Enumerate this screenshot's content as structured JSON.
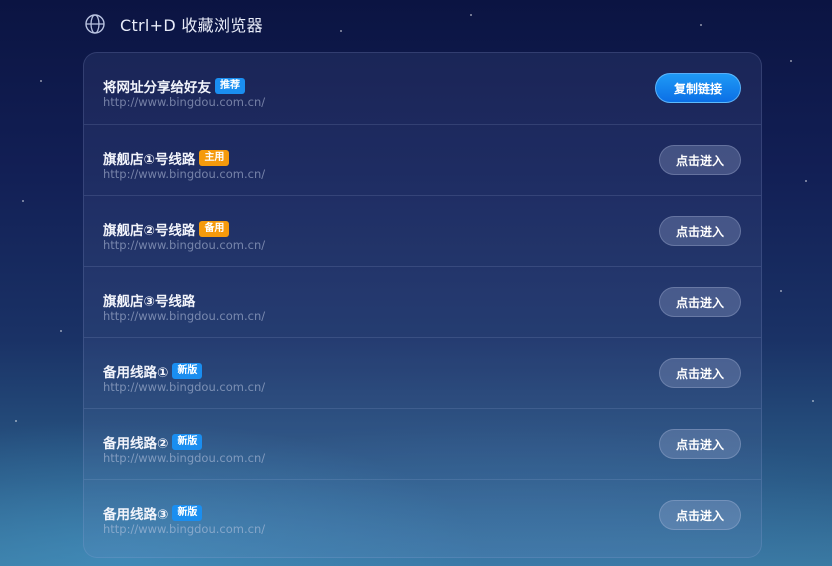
{
  "header": {
    "icon": "globe-icon",
    "title": "Ctrl+D 收藏浏览器"
  },
  "rows": [
    {
      "name": "将网址分享给好友",
      "tag": "推荐",
      "tag_color": "#1a8ef0",
      "url": "http://www.bingdou.com.cn/",
      "button": "复制链接",
      "button_style": "primary"
    },
    {
      "name": "旗舰店①号线路",
      "tag": "主用",
      "tag_color": "#f59a0c",
      "url": "http://www.bingdou.com.cn/",
      "button": "点击进入"
    },
    {
      "name": "旗舰店②号线路",
      "tag": "备用",
      "tag_color": "#f59a0c",
      "url": "http://www.bingdou.com.cn/",
      "button": "点击进入"
    },
    {
      "name": "旗舰店③号线路",
      "tag": "",
      "url": "http://www.bingdou.com.cn/",
      "button": "点击进入"
    },
    {
      "name": "备用线路①",
      "tag": "新版",
      "tag_color": "#1a8ef0",
      "url": "http://www.bingdou.com.cn/",
      "button": "点击进入"
    },
    {
      "name": "备用线路②",
      "tag": "新版",
      "tag_color": "#1a8ef0",
      "url": "http://www.bingdou.com.cn/",
      "button": "点击进入"
    },
    {
      "name": "备用线路③",
      "tag": "新版",
      "tag_color": "#1a8ef0",
      "url": "http://www.bingdou.com.cn/",
      "button": "点击进入"
    }
  ]
}
